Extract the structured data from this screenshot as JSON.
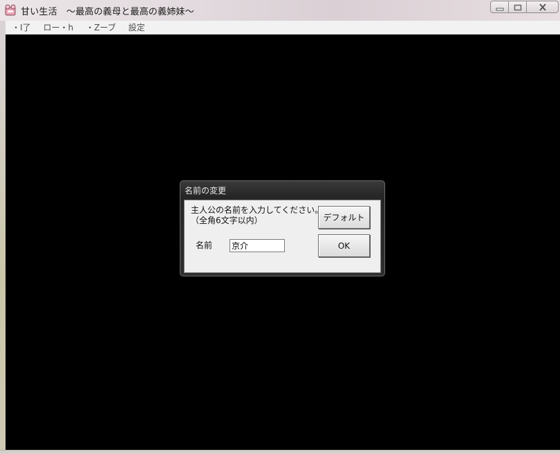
{
  "window": {
    "title": "甘い生活　～最高の義母と最高の義姉妹～",
    "app_icon": "game-app-icon",
    "caption_buttons": [
      "minimize-icon",
      "maximize-icon",
      "close-icon"
    ]
  },
  "menubar": {
    "items": [
      {
        "label": "・I了"
      },
      {
        "label": "ロー・h"
      },
      {
        "label": "・Zーブ"
      },
      {
        "label": "設定"
      }
    ]
  },
  "dialog": {
    "title": "名前の変更",
    "prompt_line1": "主人公の名前を入力してください。",
    "prompt_line2": "（全角6文字以内）",
    "name_label": "名前",
    "name_value": "京介",
    "default_button": "デフォルト",
    "ok_button": "OK"
  },
  "colors": {
    "client_background": "#000000",
    "dialog_frame": "#2a2a2a",
    "dialog_body": "#efefef"
  }
}
